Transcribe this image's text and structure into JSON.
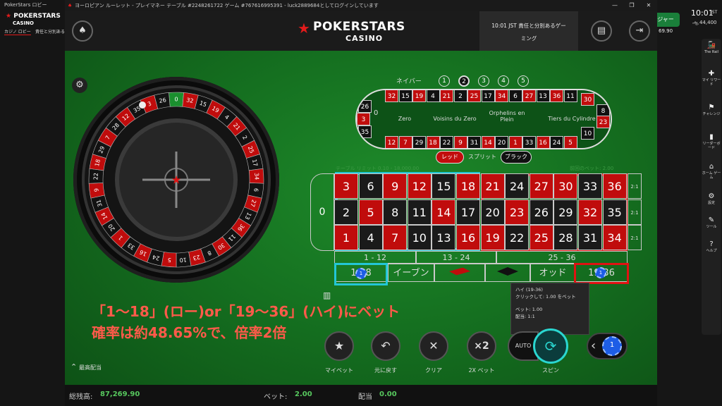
{
  "window": {
    "lobby_title": "PokerStars ロビー",
    "title": "ヨーロピアン ルーレット - プレイマネー テーブル #2248261722 ゲーム #767616995391 - luck2889684としてログインしています",
    "minimize": "—",
    "restore": "❐",
    "close": "✕"
  },
  "lobby": {
    "logo1": "POKERSTARS",
    "logo2": "CASINO",
    "menu_casino": "カジノ ロビー",
    "menu_responsible": "責任と分別ある"
  },
  "header": {
    "brand_main": "POKERSTARS",
    "brand_sub": "CASINO",
    "info_text_1": "10:01 JST 責任と分別あるゲー",
    "info_text_2": "ミング",
    "spade_icon": "♠",
    "cashier_icon": "▤",
    "exit_icon": "⇥"
  },
  "right": {
    "time": "10:01",
    "unit": "JST",
    "balance_icon": "ஆ",
    "balance": "44,400",
    "cashier_button": "ジャー",
    "side_balance": "69.90",
    "rail": [
      {
        "icon": "🚂",
        "label": "The Rail"
      },
      {
        "icon": "✚",
        "label": "マイ リワード"
      },
      {
        "icon": "⚑",
        "label": "チャレンジ"
      },
      {
        "icon": "▮",
        "label": "リーダーボード"
      },
      {
        "icon": "⌂",
        "label": "ホーム ゲーム"
      },
      {
        "icon": "⚙",
        "label": "設定"
      },
      {
        "icon": "✎",
        "label": "ツール"
      },
      {
        "icon": "?",
        "label": "ヘルプ"
      }
    ]
  },
  "racetrack": {
    "neighbor_label": "ネイバー",
    "neighbor_options": [
      "1",
      "2",
      "3",
      "4",
      "5"
    ],
    "top_row": [
      {
        "n": "32",
        "c": "red"
      },
      {
        "n": "15",
        "c": "blk"
      },
      {
        "n": "19",
        "c": "red"
      },
      {
        "n": "4",
        "c": "blk"
      },
      {
        "n": "21",
        "c": "red"
      },
      {
        "n": "2",
        "c": "blk"
      },
      {
        "n": "25",
        "c": "red"
      },
      {
        "n": "17",
        "c": "blk"
      },
      {
        "n": "34",
        "c": "red"
      },
      {
        "n": "6",
        "c": "blk"
      },
      {
        "n": "27",
        "c": "red"
      },
      {
        "n": "13",
        "c": "blk"
      },
      {
        "n": "36",
        "c": "red"
      },
      {
        "n": "11",
        "c": "blk"
      }
    ],
    "bottom_row": [
      {
        "n": "12",
        "c": "red"
      },
      {
        "n": "35",
        "c": "blk"
      },
      {
        "n": "3",
        "c": "red"
      },
      {
        "n": "26",
        "c": "blk"
      },
      {
        "n": "0",
        "c": "grn"
      },
      {
        "n": "32",
        "c": "red"
      }
    ],
    "bottom_main": [
      {
        "n": "12",
        "c": "red"
      },
      {
        "n": "7",
        "c": "red"
      },
      {
        "n": "29",
        "c": "blk"
      },
      {
        "n": "18",
        "c": "red"
      },
      {
        "n": "22",
        "c": "blk"
      },
      {
        "n": "9",
        "c": "red"
      },
      {
        "n": "31",
        "c": "blk"
      },
      {
        "n": "14",
        "c": "red"
      },
      {
        "n": "20",
        "c": "blk"
      },
      {
        "n": "1",
        "c": "red"
      },
      {
        "n": "33",
        "c": "blk"
      },
      {
        "n": "16",
        "c": "red"
      },
      {
        "n": "24",
        "c": "blk"
      },
      {
        "n": "5",
        "c": "red"
      }
    ],
    "left_end": [
      {
        "n": "26",
        "c": "blk"
      },
      {
        "n": "3",
        "c": "red"
      },
      {
        "n": "35",
        "c": "blk"
      }
    ],
    "right_end": [
      {
        "n": "30",
        "c": "red"
      },
      {
        "n": "8",
        "c": "blk"
      },
      {
        "n": "23",
        "c": "red"
      },
      {
        "n": "10",
        "c": "blk"
      }
    ],
    "sections": [
      "Zero",
      "Voisins du Zero",
      "Orphelins en Plein",
      "Tiers du Cylindre"
    ],
    "zero": "0",
    "split": {
      "red": "レッド",
      "mid": "スプリット",
      "black": "ブラック"
    }
  },
  "table": {
    "limit_left": "テーブル リミット 0.10 - 18,000.00",
    "limit_right": "前回のベット: 2.00",
    "zero": "0",
    "rows": [
      [
        {
          "n": "3",
          "c": "red"
        },
        {
          "n": "6",
          "c": "blk"
        },
        {
          "n": "9",
          "c": "red"
        },
        {
          "n": "12",
          "c": "red"
        },
        {
          "n": "15",
          "c": "blk"
        },
        {
          "n": "18",
          "c": "red"
        },
        {
          "n": "21",
          "c": "red"
        },
        {
          "n": "24",
          "c": "blk"
        },
        {
          "n": "27",
          "c": "red"
        },
        {
          "n": "30",
          "c": "red"
        },
        {
          "n": "33",
          "c": "blk"
        },
        {
          "n": "36",
          "c": "red"
        }
      ],
      [
        {
          "n": "2",
          "c": "blk"
        },
        {
          "n": "5",
          "c": "red"
        },
        {
          "n": "8",
          "c": "blk"
        },
        {
          "n": "11",
          "c": "blk"
        },
        {
          "n": "14",
          "c": "red"
        },
        {
          "n": "17",
          "c": "blk"
        },
        {
          "n": "20",
          "c": "blk"
        },
        {
          "n": "23",
          "c": "red"
        },
        {
          "n": "26",
          "c": "blk"
        },
        {
          "n": "29",
          "c": "blk"
        },
        {
          "n": "32",
          "c": "red"
        },
        {
          "n": "35",
          "c": "blk"
        }
      ],
      [
        {
          "n": "1",
          "c": "red"
        },
        {
          "n": "4",
          "c": "blk"
        },
        {
          "n": "7",
          "c": "red"
        },
        {
          "n": "10",
          "c": "blk"
        },
        {
          "n": "13",
          "c": "blk"
        },
        {
          "n": "16",
          "c": "red"
        },
        {
          "n": "19",
          "c": "red"
        },
        {
          "n": "22",
          "c": "blk"
        },
        {
          "n": "25",
          "c": "red"
        },
        {
          "n": "28",
          "c": "blk"
        },
        {
          "n": "31",
          "c": "blk"
        },
        {
          "n": "34",
          "c": "red"
        }
      ]
    ],
    "col_bets": [
      "2:1",
      "2:1",
      "2:1"
    ],
    "dozens": [
      "1 - 12",
      "13 - 24",
      "25 - 36"
    ],
    "outside": {
      "low": "1-18",
      "even": "イーブン",
      "odd": "オッド",
      "high": "19-36"
    },
    "chip_value": "1"
  },
  "tooltip": {
    "line1": "ハイ (19-36)",
    "line2": "クリックして: 1.00 をベット",
    "line3": "ベット: 1.00",
    "line4": "配当: 1:1"
  },
  "annotation": {
    "line1": "「1〜18」(ロー)or「19〜36」(ハイ)にベット",
    "line2": "確率は約48.65%で、倍率2倍"
  },
  "controls": {
    "mybet": {
      "icon": "★",
      "label": "マイベット"
    },
    "undo": {
      "icon": "↶",
      "label": "元に戻す"
    },
    "clear": {
      "icon": "✕",
      "label": "クリア"
    },
    "double": {
      "icon": "×2",
      "label": "2X ベット"
    },
    "auto": "AUTO",
    "spin": {
      "icon": "⟳",
      "label": "スピン"
    },
    "chip": "1",
    "prev": "‹",
    "max_payout": "最高配当",
    "max_icon": "⌃"
  },
  "footer": {
    "balance_label": "総残高:",
    "balance_value": "87,269.90",
    "bet_label": "ベット:",
    "bet_value": "2.00",
    "payout_label": "配当",
    "payout_value": "0.00"
  },
  "colors": {
    "red": "#c00c0c",
    "black": "#1a1a1a",
    "felt": "#157020",
    "cyan": "#23c6d6",
    "accent_red": "#e01212"
  }
}
